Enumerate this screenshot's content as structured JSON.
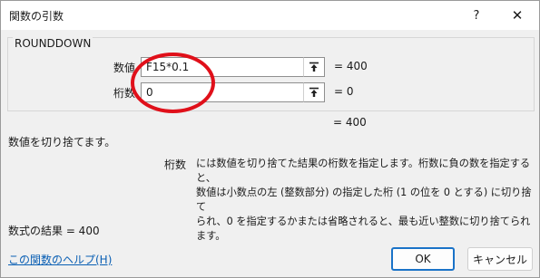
{
  "window": {
    "title": "関数の引数",
    "help_glyph": "?",
    "close_glyph": "✕"
  },
  "function": {
    "name": "ROUNDDOWN",
    "result_line": "=  400",
    "description": "数値を切り捨てます。"
  },
  "arguments": [
    {
      "label": "数値",
      "value": "F15*0.1",
      "result": "=  400"
    },
    {
      "label": "桁数",
      "value": "0",
      "result": "=  0"
    }
  ],
  "arg_help": {
    "name": "桁数",
    "lines": [
      "には数値を切り捨てた結果の桁数を指定します。桁数に負の数を指定すると、",
      "数値は小数点の左 (整数部分) の指定した桁 (1 の位を 0 とする) に切り捨て",
      "られ、0 を指定するかまたは省略されると、最も近い整数に切り捨てられます。"
    ]
  },
  "formula_result": "数式の結果 =   400",
  "help_link": "この関数のヘルプ(H)",
  "buttons": {
    "ok": "OK",
    "cancel": "キャンセル"
  },
  "icons": {
    "ref_button": "collapse-dialog-arrow-icon"
  },
  "colors": {
    "annotation_circle": "#e0101a",
    "ok_border": "#1a73c8",
    "link": "#0a5fb4"
  }
}
